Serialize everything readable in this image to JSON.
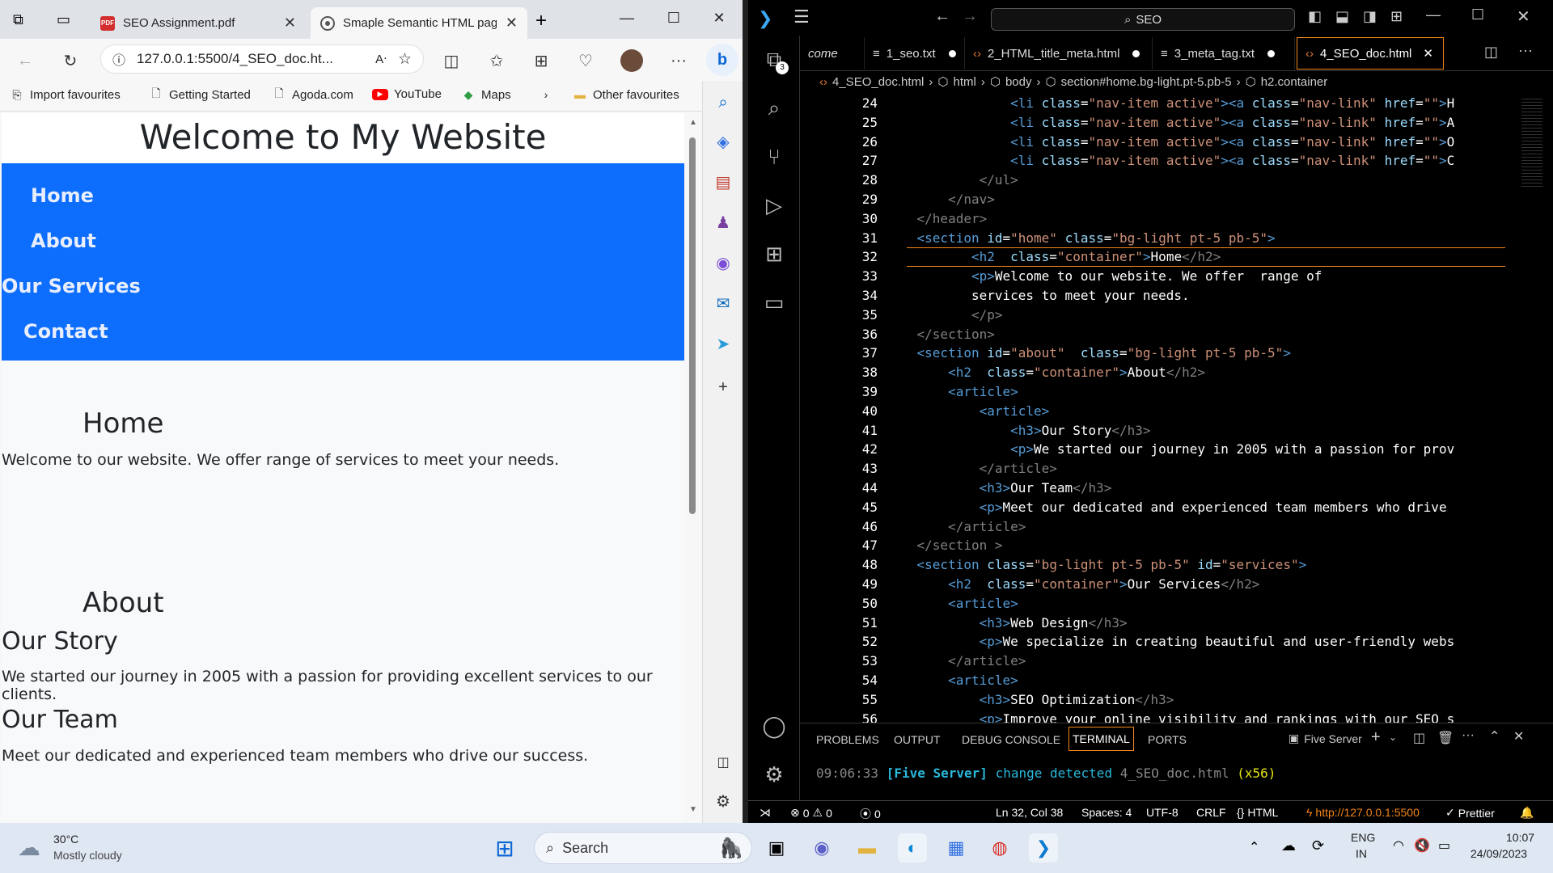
{
  "edge": {
    "tabs": [
      {
        "title": "SEO Assignment.pdf",
        "icon": "pdf-icon"
      },
      {
        "title": "Smaple Semantic HTML page",
        "icon": "live-server-icon"
      }
    ],
    "address": "127.0.0.1:5500/4_SEO_doc.ht...",
    "favourites": [
      "Import favourites",
      "Getting Started",
      "Agoda.com",
      "YouTube",
      "Maps",
      "Other favourites"
    ],
    "page": {
      "site_title": "Welcome to My Website",
      "nav": [
        "Home",
        "About",
        "Our Services",
        "Contact"
      ],
      "home_heading": "Home",
      "home_text": "Welcome to our website. We offer range of services to meet your needs.",
      "about_heading": "About",
      "story_heading": "Our Story",
      "story_text": "We started our journey in 2005 with a passion for providing excellent services to our clients.",
      "team_heading": "Our Team",
      "team_text": "Meet our dedicated and experienced team members who drive our success."
    }
  },
  "vscode": {
    "command_center": "SEO",
    "explorer_badge": "3",
    "tabs": [
      {
        "label": "come",
        "modified": false
      },
      {
        "label": "1_seo.txt",
        "modified": true
      },
      {
        "label": "2_HTML_title_meta.html",
        "modified": true
      },
      {
        "label": "3_meta_tag.txt",
        "modified": true
      },
      {
        "label": "4_SEO_doc.html",
        "modified": false
      }
    ],
    "breadcrumbs": [
      "4_SEO_doc.html",
      "html",
      "body",
      "section#home.bg-light.pt-5.pb-5",
      "h2.container"
    ],
    "panel_tabs": [
      "PROBLEMS",
      "OUTPUT",
      "DEBUG CONSOLE",
      "TERMINAL",
      "PORTS"
    ],
    "panel_server": "Five Server",
    "terminal": {
      "time": "09:06:33",
      "tag": "[Five Server]",
      "msg": "change detected",
      "file": "4_SEO_doc.html",
      "count": "(x56)"
    },
    "status": {
      "errors": "0",
      "warnings": "0",
      "ports": "0",
      "position": "Ln 32, Col 38",
      "spaces": "Spaces: 4",
      "encoding": "UTF-8",
      "eol": "CRLF",
      "language": "HTML",
      "server": "http://127.0.0.1:5500",
      "formatter": "Prettier"
    }
  },
  "taskbar": {
    "weather_temp": "30°C",
    "weather_desc": "Mostly cloudy",
    "search": "Search",
    "lang1": "ENG",
    "lang2": "IN",
    "time": "10:07",
    "date": "24/09/2023"
  }
}
